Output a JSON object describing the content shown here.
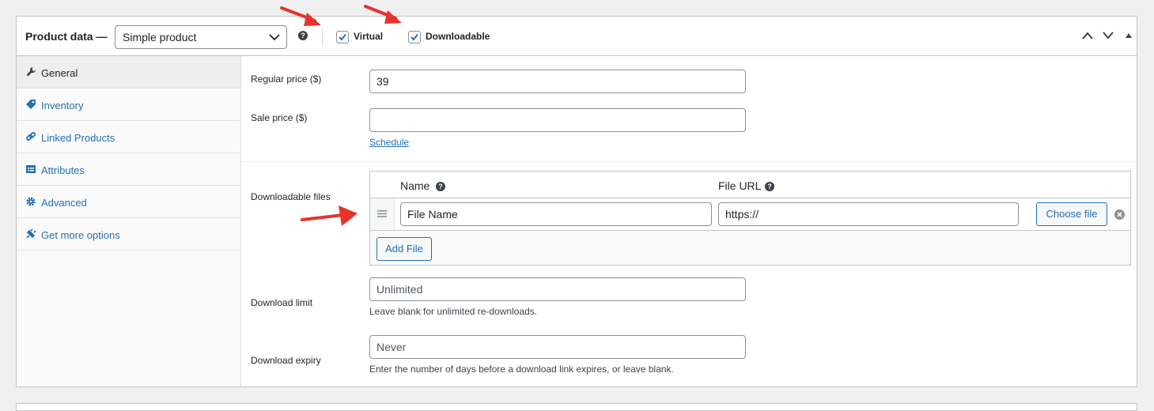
{
  "header": {
    "title": "Product data —",
    "product_type": "Simple product",
    "help_glyph": "?",
    "virtual": {
      "label": "Virtual",
      "checked": true
    },
    "downloadable": {
      "label": "Downloadable",
      "checked": true
    }
  },
  "sidebar": {
    "items": [
      {
        "label": "General",
        "icon": "wrench-icon",
        "active": true
      },
      {
        "label": "Inventory",
        "icon": "tag-icon"
      },
      {
        "label": "Linked Products",
        "icon": "link-icon"
      },
      {
        "label": "Attributes",
        "icon": "table-icon"
      },
      {
        "label": "Advanced",
        "icon": "gear-icon"
      },
      {
        "label": "Get more options",
        "icon": "plugin-icon"
      }
    ]
  },
  "general": {
    "regular_price_label": "Regular price ($)",
    "regular_price_value": "39",
    "sale_price_label": "Sale price ($)",
    "sale_price_value": "",
    "schedule_link": "Schedule",
    "downloadable_files_label": "Downloadable files",
    "files_table": {
      "name_header": "Name",
      "url_header": "File URL",
      "rows": [
        {
          "name": "File Name",
          "url": "https://"
        }
      ],
      "choose_file_label": "Choose file",
      "add_file_label": "Add File"
    },
    "download_limit_label": "Download limit",
    "download_limit_placeholder": "Unlimited",
    "download_limit_hint": "Leave blank for unlimited re-downloads.",
    "download_expiry_label": "Download expiry",
    "download_expiry_placeholder": "Never",
    "download_expiry_hint": "Enter the number of days before a download link expires, or leave blank."
  },
  "colors": {
    "accent": "#2271b1",
    "annotation_arrow": "#e8322b",
    "border": "#c3c4c7"
  }
}
